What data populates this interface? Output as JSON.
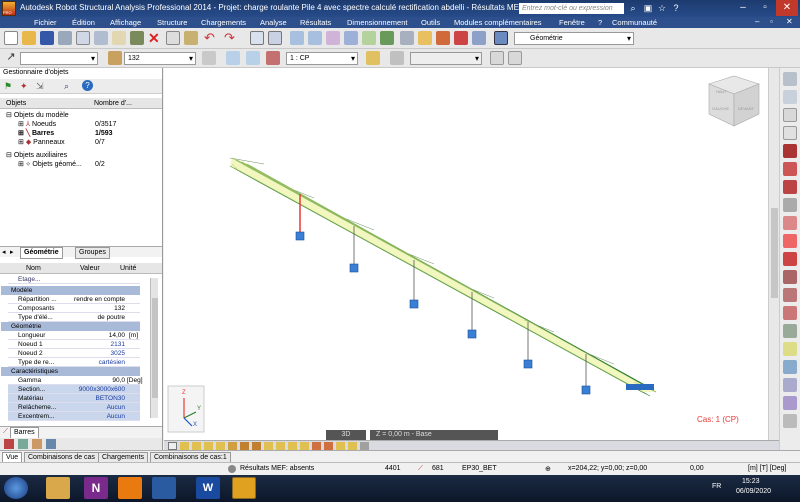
{
  "window": {
    "title": "Autodesk Robot Structural Analysis Professional 2014 - Projet: charge roulante Pile 4 avec spectre calculé rectification abdelli - Résultats MEF: a...",
    "search_placeholder": "Entrez mot-clé ou expression",
    "logo_text": "PRO"
  },
  "menu": [
    "Fichier",
    "Édition",
    "Affichage",
    "Structure",
    "Chargements",
    "Analyse",
    "Résultats",
    "Dimensionnement",
    "Outils",
    "Modules complémentaires",
    "Fenêtre",
    "?",
    "Communauté"
  ],
  "toolbar": {
    "layout_select": "Géométrie",
    "number_select": "132",
    "case_select": "1 : CP"
  },
  "object_manager": {
    "title": "Gestionnaire d'objets",
    "col_objects": "Objets",
    "col_count": "Nombre d'...",
    "model_objects": "Objets du modèle",
    "items": [
      {
        "label": "Noeuds",
        "count": "0/3517"
      },
      {
        "label": "Barres",
        "count": "1/593"
      },
      {
        "label": "Panneaux",
        "count": "0/7"
      }
    ],
    "aux_objects": "Objets auxiliaires",
    "aux_items": [
      {
        "label": "Objets géomé...",
        "count": "0/2"
      }
    ]
  },
  "tabs": {
    "geometry": "Géométrie",
    "groups": "Groupes",
    "bars": "Barres"
  },
  "properties": {
    "col_name": "Nom",
    "col_value": "Valeur",
    "col_unit": "Unité",
    "top_row": "Etage...",
    "sections": [
      {
        "title": "Modèle",
        "rows": [
          {
            "n": "Répartition ...",
            "v": "rendre en compte",
            "u": ""
          },
          {
            "n": "Composants",
            "v": "132",
            "u": ""
          },
          {
            "n": "Type d'élé...",
            "v": "de poutre",
            "u": ""
          }
        ]
      },
      {
        "title": "Géométrie",
        "rows": [
          {
            "n": "Longueur",
            "v": "14,00",
            "u": "[m]"
          },
          {
            "n": "Noeud 1",
            "v": "2131",
            "u": ""
          },
          {
            "n": "Noeud 2",
            "v": "3025",
            "u": ""
          },
          {
            "n": "Type de re...",
            "v": "cartésien",
            "u": ""
          }
        ]
      },
      {
        "title": "Caractéristiques",
        "rows": [
          {
            "n": "Gamma",
            "v": "90,0",
            "u": "[Deg]"
          },
          {
            "n": "Section...",
            "v": "9000x3000x600",
            "u": ""
          },
          {
            "n": "Matériau",
            "v": "BETON30",
            "u": ""
          },
          {
            "n": "Relâcheme...",
            "v": "Aucun",
            "u": ""
          },
          {
            "n": "Excentrem...",
            "v": "Aucun",
            "u": ""
          }
        ]
      }
    ]
  },
  "viewport": {
    "case_label": "Cas: 1 (CP)",
    "view_mode": "3D",
    "level": "Z = 0,00 m - Base",
    "cube_labels": [
      "HAUT",
      "GAUCHE",
      "DEVANT"
    ],
    "axes": [
      "Z",
      "Y",
      "X"
    ]
  },
  "bottom_tabs": [
    "Vue",
    "Combinaisons de cas",
    "Chargements",
    "Combinaisons de cas:1"
  ],
  "status": {
    "results": "Résultats MEF: absents",
    "v1": "4401",
    "v2": "681",
    "material": "EP30_BET",
    "coords": "x=204,22; y=0,00; z=0,00",
    "value": "0,00",
    "units": "[m] [T] [Deg]"
  },
  "taskbar": {
    "lang": "FR",
    "time": "15:23",
    "date": "06/09/2020"
  },
  "colors": {
    "title_bar": "#1c3a6e",
    "structure_line": "#2e7d32",
    "support": "#3a7fd6",
    "selected_bar": "#e53935",
    "case_label": "#e53935"
  }
}
